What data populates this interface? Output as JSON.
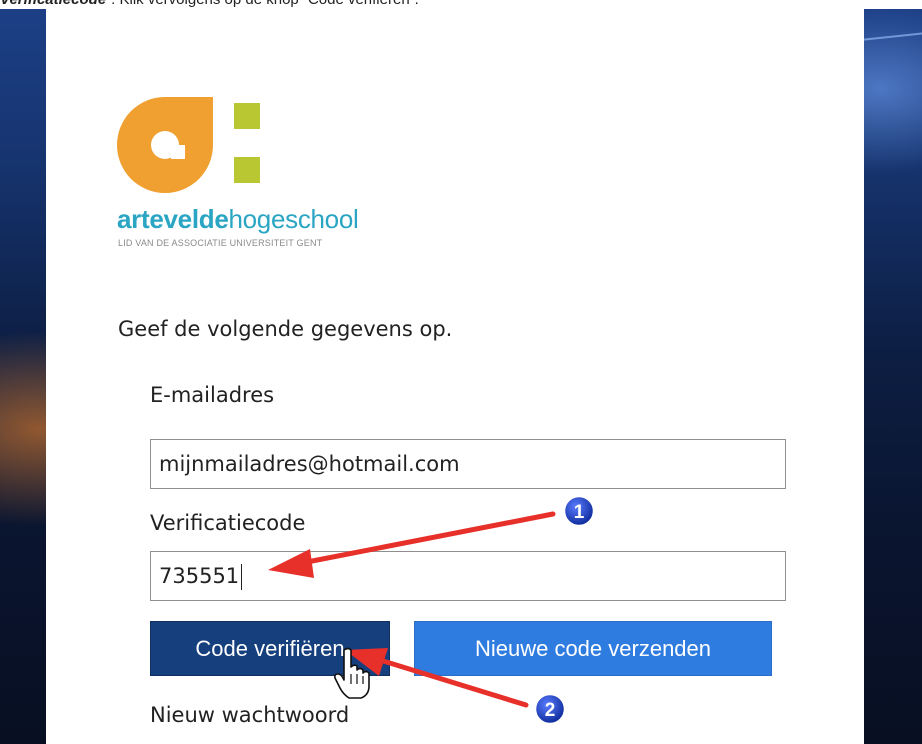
{
  "caption": {
    "bold_part": "Verificatiecode",
    "rest": "”. Klik vervolgens op de knop “Code verifiëren”."
  },
  "logo": {
    "name_bold": "artevelde",
    "name_light": "hogeschool",
    "tagline": "LID VAN DE ASSOCIATIE UNIVERSITEIT GENT",
    "colors": {
      "orange": "#f0a030",
      "green": "#b9c832",
      "blue": "#2aa5c3"
    }
  },
  "form": {
    "intro": "Geef de volgende gegevens op.",
    "email_label": "E-mailadres",
    "email_value": "mijnmailadres@hotmail.com",
    "code_label": "Verificatiecode",
    "code_value": "735551",
    "verify_button": "Code verifiëren",
    "resend_button": "Nieuwe code verzenden",
    "new_password_label": "Nieuw wachtwoord"
  },
  "annotations": {
    "marker_1": "1",
    "marker_2": "2",
    "arrow_color": "#e8302a",
    "marker_color": "#1a3fb0"
  }
}
